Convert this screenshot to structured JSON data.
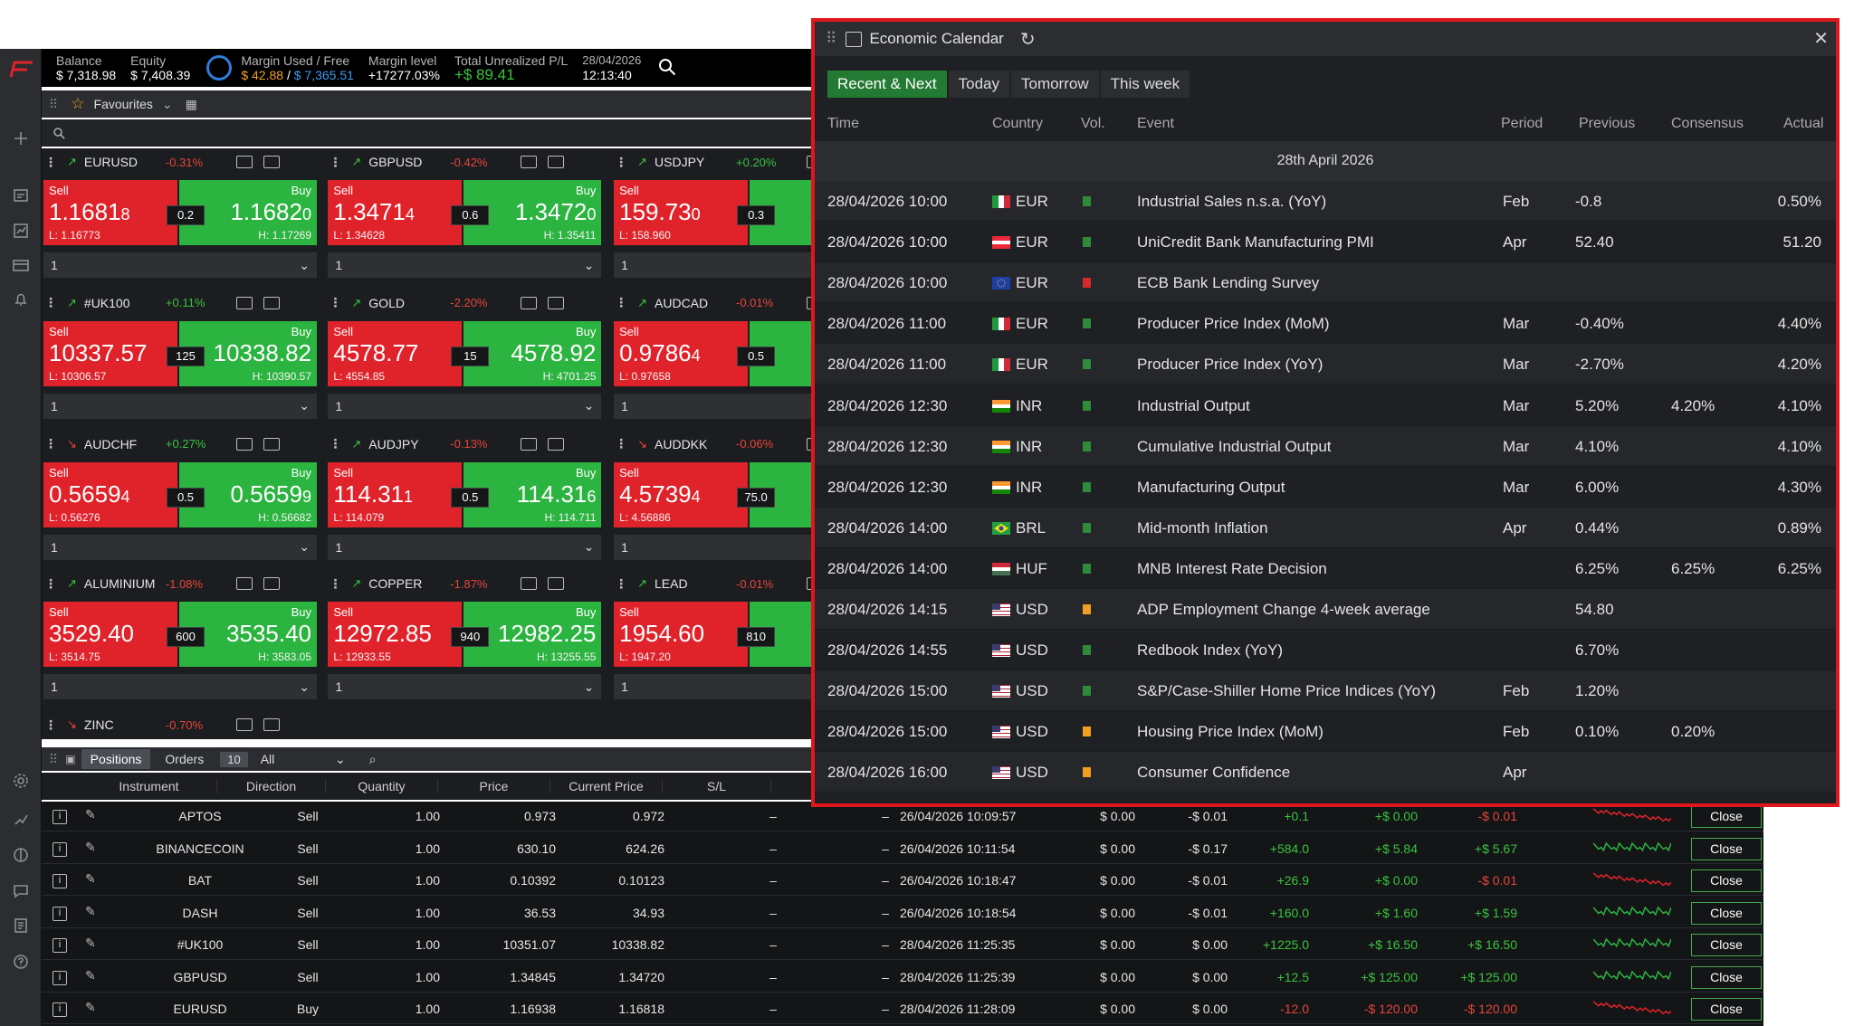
{
  "account": {
    "balance_label": "Balance",
    "balance": "$ 7,318.98",
    "equity_label": "Equity",
    "equity": "$ 7,408.39",
    "margin_label": "Margin Used / Free",
    "margin_used": "$ 42.88",
    "margin_sep": " / ",
    "margin_free": "$ 7,365.51",
    "margin_level_label": "Margin level",
    "margin_level": "+17277.03%",
    "unrealized_label": "Total Unrealized P/L",
    "unrealized": "+$ 89.41",
    "date": "28/04/2026",
    "time": "12:13:40"
  },
  "favourites": {
    "label": "Favourites"
  },
  "tiles": [
    {
      "symbol": "EURUSD",
      "trend": "up",
      "change": "-0.31%",
      "change_dir": "neg",
      "sell_label": "Sell",
      "buy_label": "Buy",
      "sell_main": "1.1681",
      "sell_small": "8",
      "buy_main": "1.1682",
      "buy_small": "0",
      "spread": "0.2",
      "low": "L: 1.16773",
      "high": "H: 1.17269",
      "qty": "1"
    },
    {
      "symbol": "GBPUSD",
      "trend": "up",
      "change": "-0.42%",
      "change_dir": "neg",
      "sell_label": "Sell",
      "buy_label": "Buy",
      "sell_main": "1.3471",
      "sell_small": "4",
      "buy_main": "1.3472",
      "buy_small": "0",
      "spread": "0.6",
      "low": "L: 1.34628",
      "high": "H: 1.35411",
      "qty": "1"
    },
    {
      "symbol": "USDJPY",
      "trend": "up",
      "change": "+0.20%",
      "change_dir": "pos",
      "sell_label": "Sell",
      "buy_label": "",
      "sell_main": "159.73",
      "sell_small": "0",
      "buy_main": "",
      "buy_small": "",
      "spread": "0.3",
      "low": "L: 158.960",
      "high": "",
      "qty": "1"
    },
    {
      "symbol": "#UK100",
      "trend": "up",
      "change": "+0.11%",
      "change_dir": "pos",
      "sell_label": "Sell",
      "buy_label": "Buy",
      "sell_main": "10337.57",
      "sell_small": "",
      "buy_main": "10338.82",
      "buy_small": "",
      "spread": "125",
      "low": "L: 10306.57",
      "high": "H: 10390.57",
      "qty": "1"
    },
    {
      "symbol": "GOLD",
      "trend": "up",
      "change": "-2.20%",
      "change_dir": "neg",
      "sell_label": "Sell",
      "buy_label": "Buy",
      "sell_main": "4578.77",
      "sell_small": "",
      "buy_main": "4578.92",
      "buy_small": "",
      "spread": "15",
      "low": "L: 4554.85",
      "high": "H: 4701.25",
      "qty": "1"
    },
    {
      "symbol": "AUDCAD",
      "trend": "up",
      "change": "-0.01%",
      "change_dir": "neg",
      "sell_label": "Sell",
      "buy_label": "",
      "sell_main": "0.9786",
      "sell_small": "4",
      "buy_main": "",
      "buy_small": "",
      "spread": "0.5",
      "low": "L: 0.97658",
      "high": "",
      "qty": "1"
    },
    {
      "symbol": "AUDCHF",
      "trend": "down",
      "change": "+0.27%",
      "change_dir": "pos",
      "sell_label": "Sell",
      "buy_label": "Buy",
      "sell_main": "0.5659",
      "sell_small": "4",
      "buy_main": "0.5659",
      "buy_small": "9",
      "spread": "0.5",
      "low": "L: 0.56276",
      "high": "H: 0.56682",
      "qty": "1"
    },
    {
      "symbol": "AUDJPY",
      "trend": "up",
      "change": "-0.13%",
      "change_dir": "neg",
      "sell_label": "Sell",
      "buy_label": "Buy",
      "sell_main": "114.31",
      "sell_small": "1",
      "buy_main": "114.31",
      "buy_small": "6",
      "spread": "0.5",
      "low": "L: 114.079",
      "high": "H: 114.711",
      "qty": "1"
    },
    {
      "symbol": "AUDDKK",
      "trend": "down",
      "change": "-0.06%",
      "change_dir": "neg",
      "sell_label": "Sell",
      "buy_label": "",
      "sell_main": "4.5739",
      "sell_small": "4",
      "buy_main": "",
      "buy_small": "",
      "spread": "75.0",
      "low": "L: 4.56886",
      "high": "",
      "qty": "1"
    },
    {
      "symbol": "ALUMINIUM",
      "trend": "up",
      "change": "-1.08%",
      "change_dir": "neg",
      "sell_label": "Sell",
      "buy_label": "Buy",
      "sell_main": "3529.40",
      "sell_small": "",
      "buy_main": "3535.40",
      "buy_small": "",
      "spread": "600",
      "low": "L: 3514.75",
      "high": "H: 3583.05",
      "qty": "1"
    },
    {
      "symbol": "COPPER",
      "trend": "up",
      "change": "-1.87%",
      "change_dir": "neg",
      "sell_label": "Sell",
      "buy_label": "Buy",
      "sell_main": "12972.85",
      "sell_small": "",
      "buy_main": "12982.25",
      "buy_small": "",
      "spread": "940",
      "low": "L: 12933.55",
      "high": "H: 13255.55",
      "qty": "1"
    },
    {
      "symbol": "LEAD",
      "trend": "up",
      "change": "-0.01%",
      "change_dir": "neg",
      "sell_label": "Sell",
      "buy_label": "",
      "sell_main": "1954.60",
      "sell_small": "",
      "buy_main": "",
      "buy_small": "",
      "spread": "810",
      "low": "L: 1947.20",
      "high": "",
      "qty": "1"
    }
  ],
  "partial_tile": {
    "symbol": "ZINC",
    "change": "-0.70%"
  },
  "positions": {
    "tab_positions": "Positions",
    "tab_orders": "Orders",
    "count": "10",
    "filter": "All",
    "headers": [
      "Instrument",
      "Direction",
      "Quantity",
      "Price",
      "Current Price",
      "S/L"
    ],
    "rows": [
      {
        "instrument": "APTOS",
        "direction": "Sell",
        "quantity": "1.00",
        "price": "0.973",
        "current": "0.972",
        "sl": "–",
        "tp": "–",
        "open_time": "26/04/2026 10:09:57",
        "col9": "$ 0.00",
        "col10": "-$ 0.01",
        "pips": "+0.1",
        "pips_dir": "pos",
        "col12": "+$ 0.00",
        "col12_dir": "pos",
        "pl": "-$ 0.01",
        "pl_dir": "neg",
        "close": "Close"
      },
      {
        "instrument": "BINANCECOIN",
        "direction": "Sell",
        "quantity": "1.00",
        "price": "630.10",
        "current": "624.26",
        "sl": "–",
        "tp": "–",
        "open_time": "26/04/2026 10:11:54",
        "col9": "$ 0.00",
        "col10": "-$ 0.17",
        "pips": "+584.0",
        "pips_dir": "pos",
        "col12": "+$ 5.84",
        "col12_dir": "pos",
        "pl": "+$ 5.67",
        "pl_dir": "pos",
        "close": "Close"
      },
      {
        "instrument": "BAT",
        "direction": "Sell",
        "quantity": "1.00",
        "price": "0.10392",
        "current": "0.10123",
        "sl": "–",
        "tp": "–",
        "open_time": "26/04/2026 10:18:47",
        "col9": "$ 0.00",
        "col10": "-$ 0.01",
        "pips": "+26.9",
        "pips_dir": "pos",
        "col12": "+$ 0.00",
        "col12_dir": "pos",
        "pl": "-$ 0.01",
        "pl_dir": "neg",
        "close": "Close"
      },
      {
        "instrument": "DASH",
        "direction": "Sell",
        "quantity": "1.00",
        "price": "36.53",
        "current": "34.93",
        "sl": "–",
        "tp": "–",
        "open_time": "26/04/2026 10:18:54",
        "col9": "$ 0.00",
        "col10": "-$ 0.01",
        "pips": "+160.0",
        "pips_dir": "pos",
        "col12": "+$ 1.60",
        "col12_dir": "pos",
        "pl": "+$ 1.59",
        "pl_dir": "pos",
        "close": "Close"
      },
      {
        "instrument": "#UK100",
        "direction": "Sell",
        "quantity": "1.00",
        "price": "10351.07",
        "current": "10338.82",
        "sl": "–",
        "tp": "–",
        "open_time": "28/04/2026 11:25:35",
        "col9": "$ 0.00",
        "col10": "$ 0.00",
        "pips": "+1225.0",
        "pips_dir": "pos",
        "col12": "+$ 16.50",
        "col12_dir": "pos",
        "pl": "+$ 16.50",
        "pl_dir": "pos",
        "close": "Close"
      },
      {
        "instrument": "GBPUSD",
        "direction": "Sell",
        "quantity": "1.00",
        "price": "1.34845",
        "current": "1.34720",
        "sl": "–",
        "tp": "–",
        "open_time": "28/04/2026 11:25:39",
        "col9": "$ 0.00",
        "col10": "$ 0.00",
        "pips": "+12.5",
        "pips_dir": "pos",
        "col12": "+$ 125.00",
        "col12_dir": "pos",
        "pl": "+$ 125.00",
        "pl_dir": "pos",
        "close": "Close"
      },
      {
        "instrument": "EURUSD",
        "direction": "Buy",
        "quantity": "1.00",
        "price": "1.16938",
        "current": "1.16818",
        "sl": "–",
        "tp": "–",
        "open_time": "28/04/2026 11:28:09",
        "col9": "$ 0.00",
        "col10": "$ 0.00",
        "pips": "-12.0",
        "pips_dir": "neg",
        "col12": "-$ 120.00",
        "col12_dir": "neg",
        "pl": "-$ 120.00",
        "pl_dir": "neg",
        "close": "Close"
      }
    ]
  },
  "calendar": {
    "title": "Economic Calendar",
    "tabs": [
      "Recent & Next",
      "Today",
      "Tomorrow",
      "This week"
    ],
    "columns": {
      "time": "Time",
      "country": "Country",
      "vol": "Vol.",
      "event": "Event",
      "period": "Period",
      "previous": "Previous",
      "consensus": "Consensus",
      "actual": "Actual"
    },
    "date_heading": "28th April 2026",
    "events": [
      {
        "time": "28/04/2026 10:00",
        "flag": "it",
        "currency": "EUR",
        "vol": "low",
        "event": "Industrial Sales n.s.a. (YoY)",
        "period": "Feb",
        "previous": "-0.8",
        "consensus": "",
        "actual": "0.50%"
      },
      {
        "time": "28/04/2026 10:00",
        "flag": "at",
        "currency": "EUR",
        "vol": "low",
        "event": "UniCredit Bank Manufacturing PMI",
        "period": "Apr",
        "previous": "52.40",
        "consensus": "",
        "actual": "51.20"
      },
      {
        "time": "28/04/2026 10:00",
        "flag": "eu",
        "currency": "EUR",
        "vol": "high",
        "event": "ECB Bank Lending Survey",
        "period": "",
        "previous": "",
        "consensus": "",
        "actual": ""
      },
      {
        "time": "28/04/2026 11:00",
        "flag": "it",
        "currency": "EUR",
        "vol": "low",
        "event": "Producer Price Index (MoM)",
        "period": "Mar",
        "previous": "-0.40%",
        "consensus": "",
        "actual": "4.40%"
      },
      {
        "time": "28/04/2026 11:00",
        "flag": "it",
        "currency": "EUR",
        "vol": "low",
        "event": "Producer Price Index (YoY)",
        "period": "Mar",
        "previous": "-2.70%",
        "consensus": "",
        "actual": "4.20%"
      },
      {
        "time": "28/04/2026 12:30",
        "flag": "in",
        "currency": "INR",
        "vol": "low",
        "event": "Industrial Output",
        "period": "Mar",
        "previous": "5.20%",
        "consensus": "4.20%",
        "actual": "4.10%"
      },
      {
        "time": "28/04/2026 12:30",
        "flag": "in",
        "currency": "INR",
        "vol": "low",
        "event": "Cumulative Industrial Output",
        "period": "Mar",
        "previous": "4.10%",
        "consensus": "",
        "actual": "4.10%"
      },
      {
        "time": "28/04/2026 12:30",
        "flag": "in",
        "currency": "INR",
        "vol": "low",
        "event": "Manufacturing Output",
        "period": "Mar",
        "previous": "6.00%",
        "consensus": "",
        "actual": "4.30%"
      },
      {
        "time": "28/04/2026 14:00",
        "flag": "br",
        "currency": "BRL",
        "vol": "low",
        "event": "Mid-month Inflation",
        "period": "Apr",
        "previous": "0.44%",
        "consensus": "",
        "actual": "0.89%"
      },
      {
        "time": "28/04/2026 14:00",
        "flag": "hu",
        "currency": "HUF",
        "vol": "low",
        "event": "MNB Interest Rate Decision",
        "period": "",
        "previous": "6.25%",
        "consensus": "6.25%",
        "actual": "6.25%"
      },
      {
        "time": "28/04/2026 14:15",
        "flag": "us",
        "currency": "USD",
        "vol": "medium",
        "event": "ADP Employment Change 4-week average",
        "period": "",
        "previous": "54.80",
        "consensus": "",
        "actual": ""
      },
      {
        "time": "28/04/2026 14:55",
        "flag": "us",
        "currency": "USD",
        "vol": "low",
        "event": "Redbook Index (YoY)",
        "period": "",
        "previous": "6.70%",
        "consensus": "",
        "actual": ""
      },
      {
        "time": "28/04/2026 15:00",
        "flag": "us",
        "currency": "USD",
        "vol": "low",
        "event": "S&P/Case-Shiller Home Price Indices (YoY)",
        "period": "Feb",
        "previous": "1.20%",
        "consensus": "",
        "actual": ""
      },
      {
        "time": "28/04/2026 15:00",
        "flag": "us",
        "currency": "USD",
        "vol": "medium",
        "event": "Housing Price Index (MoM)",
        "period": "Feb",
        "previous": "0.10%",
        "consensus": "0.20%",
        "actual": ""
      },
      {
        "time": "28/04/2026 16:00",
        "flag": "us",
        "currency": "USD",
        "vol": "medium",
        "event": "Consumer Confidence",
        "period": "Apr",
        "previous": "",
        "consensus": "",
        "actual": ""
      }
    ]
  },
  "colors": {
    "sell": "#e0232b",
    "buy": "#2cb441",
    "accent_green": "#237a33",
    "highlight_border": "#e0161c",
    "vol_low": "#2e8b3a",
    "vol_medium": "#f0a020",
    "vol_high": "#d42a2a"
  }
}
